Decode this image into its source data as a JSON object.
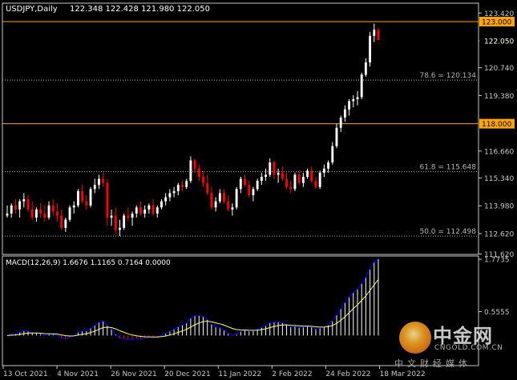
{
  "header": {
    "symbol": "USDJPY,Daily",
    "ohlc": "122.348 122.428 121.980 122.050"
  },
  "macd": {
    "label": "MACD(12,26,9) 1.6676 1.1165 0.7164 0.0000"
  },
  "colors": {
    "background": "#000000",
    "axis": "#c8c8c8",
    "bull": "#ffffff",
    "bear": "#ff0000",
    "horizontal_line": "#ffa500",
    "fib_line": "#b4b4b4",
    "macd_main": "#0000ff",
    "macd_signal": "#ffff66",
    "histogram_positive": "#ffffff",
    "histogram_negative": "#ff0000",
    "price_label_bg": "#ffa500"
  },
  "watermark": {
    "title": "中金网",
    "url": "CNGOLD.COM.CN",
    "subtitle": "中文财经媒体"
  },
  "chart_data": [
    {
      "type": "candlestick",
      "title": "USDJPY,Daily",
      "ylim": [
        111.6,
        123.9
      ],
      "y_ticks": [
        "123.420",
        "122.050",
        "120.740",
        "119.380",
        "116.660",
        "115.340",
        "113.980",
        "112.620",
        "111.620"
      ],
      "x_ticks": [
        "13 Oct 2021",
        "4 Nov 2021",
        "26 Nov 2021",
        "20 Dec 2021",
        "11 Jan 2022",
        "2 Feb 2022",
        "24 Feb 2022",
        "18 Mar 2022"
      ],
      "horizontal_lines": [
        {
          "value": 123.0,
          "label": "123.000"
        },
        {
          "value": 118.0,
          "label": "118.000"
        }
      ],
      "fib_levels": [
        {
          "value": 120.134,
          "label": "78.6 = 120.134"
        },
        {
          "value": 115.648,
          "label": "61.8 = 115.648"
        },
        {
          "value": 112.498,
          "label": "50.0 = 112.498"
        }
      ],
      "current_price": "122.050",
      "ohlc": [
        [
          113.5,
          114.0,
          113.4,
          113.6
        ],
        [
          113.6,
          114.1,
          113.4,
          114.0
        ],
        [
          114.0,
          114.3,
          113.6,
          113.8
        ],
        [
          113.8,
          114.3,
          113.4,
          114.2
        ],
        [
          114.2,
          114.6,
          113.9,
          114.3
        ],
        [
          114.3,
          114.5,
          113.7,
          113.8
        ],
        [
          113.8,
          114.2,
          113.3,
          113.4
        ],
        [
          113.4,
          113.9,
          113.2,
          113.8
        ],
        [
          113.8,
          114.1,
          113.4,
          113.6
        ],
        [
          113.6,
          114.0,
          113.2,
          113.4
        ],
        [
          113.4,
          114.2,
          113.3,
          114.0
        ],
        [
          114.0,
          114.3,
          113.5,
          113.7
        ],
        [
          113.7,
          114.1,
          113.2,
          113.5
        ],
        [
          113.5,
          113.8,
          112.8,
          112.9
        ],
        [
          112.9,
          113.4,
          112.7,
          113.3
        ],
        [
          113.3,
          114.0,
          113.2,
          113.9
        ],
        [
          113.9,
          114.2,
          113.6,
          114.0
        ],
        [
          114.0,
          114.8,
          113.9,
          114.7
        ],
        [
          114.7,
          115.0,
          114.1,
          114.2
        ],
        [
          114.2,
          114.5,
          113.8,
          114.0
        ],
        [
          114.0,
          114.9,
          113.9,
          114.8
        ],
        [
          114.8,
          115.3,
          114.6,
          115.0
        ],
        [
          115.0,
          115.5,
          114.8,
          115.3
        ],
        [
          115.3,
          115.6,
          114.9,
          115.1
        ],
        [
          115.1,
          115.3,
          113.0,
          113.4
        ],
        [
          113.4,
          113.8,
          113.0,
          113.5
        ],
        [
          113.5,
          113.9,
          112.6,
          112.8
        ],
        [
          112.8,
          113.3,
          112.5,
          112.9
        ],
        [
          112.9,
          113.6,
          112.8,
          113.5
        ],
        [
          113.5,
          113.9,
          113.2,
          113.4
        ],
        [
          113.4,
          113.7,
          113.0,
          113.6
        ],
        [
          113.6,
          114.0,
          113.4,
          113.9
        ],
        [
          113.9,
          114.2,
          113.5,
          113.6
        ],
        [
          113.6,
          114.0,
          113.4,
          113.8
        ],
        [
          113.8,
          114.1,
          113.6,
          114.0
        ],
        [
          114.0,
          114.3,
          113.5,
          113.6
        ],
        [
          113.6,
          114.0,
          113.4,
          113.9
        ],
        [
          113.9,
          114.3,
          113.8,
          114.2
        ],
        [
          114.2,
          114.6,
          114.0,
          114.4
        ],
        [
          114.4,
          114.8,
          114.2,
          114.6
        ],
        [
          114.6,
          114.9,
          114.4,
          114.7
        ],
        [
          114.7,
          115.1,
          114.5,
          115.0
        ],
        [
          115.0,
          115.2,
          114.7,
          114.9
        ],
        [
          114.9,
          115.3,
          114.8,
          115.2
        ],
        [
          115.2,
          116.4,
          115.1,
          116.2
        ],
        [
          116.2,
          116.3,
          115.6,
          115.8
        ],
        [
          115.8,
          116.0,
          115.2,
          115.4
        ],
        [
          115.4,
          115.7,
          114.9,
          115.1
        ],
        [
          115.1,
          115.5,
          114.5,
          114.6
        ],
        [
          114.6,
          114.9,
          113.8,
          113.9
        ],
        [
          113.9,
          114.4,
          113.7,
          114.2
        ],
        [
          114.2,
          114.8,
          114.1,
          114.6
        ],
        [
          114.6,
          114.8,
          114.1,
          114.2
        ],
        [
          114.2,
          114.5,
          113.7,
          113.8
        ],
        [
          113.8,
          114.1,
          113.5,
          113.9
        ],
        [
          113.9,
          114.9,
          113.8,
          114.8
        ],
        [
          114.8,
          115.4,
          114.6,
          115.3
        ],
        [
          115.3,
          115.5,
          114.9,
          115.0
        ],
        [
          115.0,
          115.2,
          114.4,
          114.5
        ],
        [
          114.5,
          114.9,
          114.2,
          114.8
        ],
        [
          114.8,
          115.3,
          114.7,
          115.2
        ],
        [
          115.2,
          115.6,
          115.0,
          115.4
        ],
        [
          115.4,
          115.8,
          115.2,
          115.5
        ],
        [
          115.5,
          116.3,
          115.4,
          116.1
        ],
        [
          116.1,
          116.2,
          115.3,
          115.5
        ],
        [
          115.5,
          115.8,
          115.1,
          115.6
        ],
        [
          115.6,
          115.9,
          115.2,
          115.3
        ],
        [
          115.3,
          115.6,
          114.8,
          114.9
        ],
        [
          114.9,
          115.2,
          114.6,
          114.8
        ],
        [
          114.8,
          115.6,
          114.7,
          115.5
        ],
        [
          115.5,
          115.7,
          115.0,
          115.1
        ],
        [
          115.1,
          115.6,
          114.9,
          115.4
        ],
        [
          115.4,
          115.8,
          115.3,
          115.7
        ],
        [
          115.7,
          115.9,
          115.1,
          115.2
        ],
        [
          115.2,
          115.4,
          114.8,
          114.9
        ],
        [
          114.9,
          115.7,
          114.8,
          115.6
        ],
        [
          115.6,
          116.0,
          115.4,
          115.8
        ],
        [
          115.8,
          116.2,
          115.6,
          116.1
        ],
        [
          116.1,
          117.1,
          116.0,
          116.9
        ],
        [
          116.9,
          118.0,
          116.8,
          117.8
        ],
        [
          117.8,
          118.4,
          117.6,
          118.3
        ],
        [
          118.3,
          118.9,
          118.1,
          118.7
        ],
        [
          118.7,
          119.2,
          118.4,
          119.1
        ],
        [
          119.1,
          119.4,
          118.8,
          119.2
        ],
        [
          119.2,
          119.6,
          118.9,
          119.3
        ],
        [
          119.3,
          120.5,
          119.2,
          120.4
        ],
        [
          120.4,
          121.2,
          120.3,
          121.0
        ],
        [
          121.0,
          122.5,
          120.8,
          122.3
        ],
        [
          122.3,
          122.9,
          122.0,
          122.6
        ],
        [
          122.6,
          122.7,
          122.1,
          122.1
        ]
      ]
    },
    {
      "type": "macd",
      "title": "MACD(12,26,9)",
      "values": {
        "main": 1.6676,
        "signal": 1.1165,
        "histogram": 0.7164,
        "zero": 0.0
      },
      "ylim": [
        -0.7,
        1.85
      ],
      "y_ticks": [
        "1.7735",
        "0.5555"
      ]
    }
  ]
}
